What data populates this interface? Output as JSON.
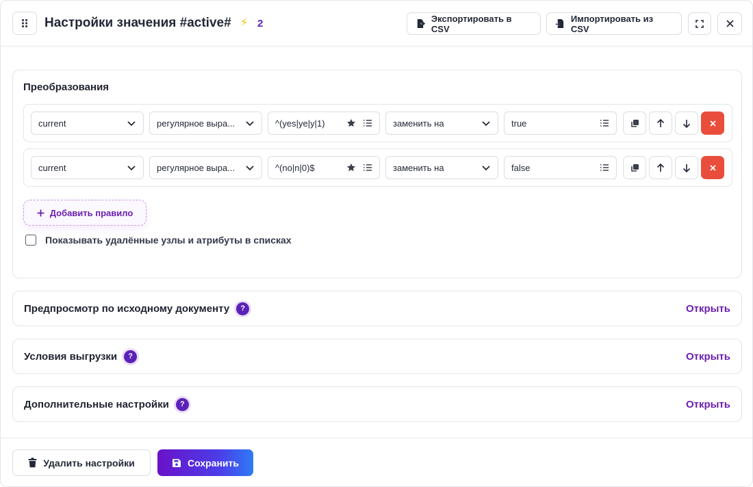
{
  "header": {
    "title": "Настройки значения #active#",
    "count": "2",
    "export_label": "Экспортировать в CSV",
    "import_label": "Импортировать из CSV"
  },
  "transforms": {
    "title": "Преобразования",
    "rules": [
      {
        "source": "current",
        "match_type": "регулярное выра...",
        "pattern": "^(yes|ye|y|1)",
        "action": "заменить на",
        "value": "true"
      },
      {
        "source": "current",
        "match_type": "регулярное выра...",
        "pattern": "^(no|n|0)$",
        "action": "заменить на",
        "value": "false"
      }
    ],
    "add_rule_label": "Добавить правило",
    "show_deleted_label": "Показывать удалённые узлы и атрибуты в списках",
    "show_deleted_checked": false
  },
  "sections": [
    {
      "title": "Предпросмотр по исходному документу",
      "open_label": "Открыть"
    },
    {
      "title": "Условия выгрузки",
      "open_label": "Открыть"
    },
    {
      "title": "Дополнительные настройки",
      "open_label": "Открыть"
    }
  ],
  "help_glyph": "?",
  "footer": {
    "delete_label": "Удалить настройки",
    "save_label": "Сохранить"
  },
  "colors": {
    "accent": "#6a1fb0",
    "danger": "#e94e3c",
    "bolt": "#f2b705"
  },
  "icons": {
    "drag": "drag-handle-icon",
    "bolt": "lightning-icon",
    "export": "file-export-icon",
    "import": "file-import-icon",
    "expand": "expand-icon",
    "close": "close-icon",
    "chevron": "chevron-down-icon",
    "star": "star-icon",
    "list": "list-icon",
    "copy": "copy-icon",
    "up": "arrow-up-icon",
    "down": "arrow-down-icon",
    "delete": "x-icon",
    "plus": "plus-icon",
    "trash": "trash-icon",
    "save": "floppy-disk-icon"
  }
}
